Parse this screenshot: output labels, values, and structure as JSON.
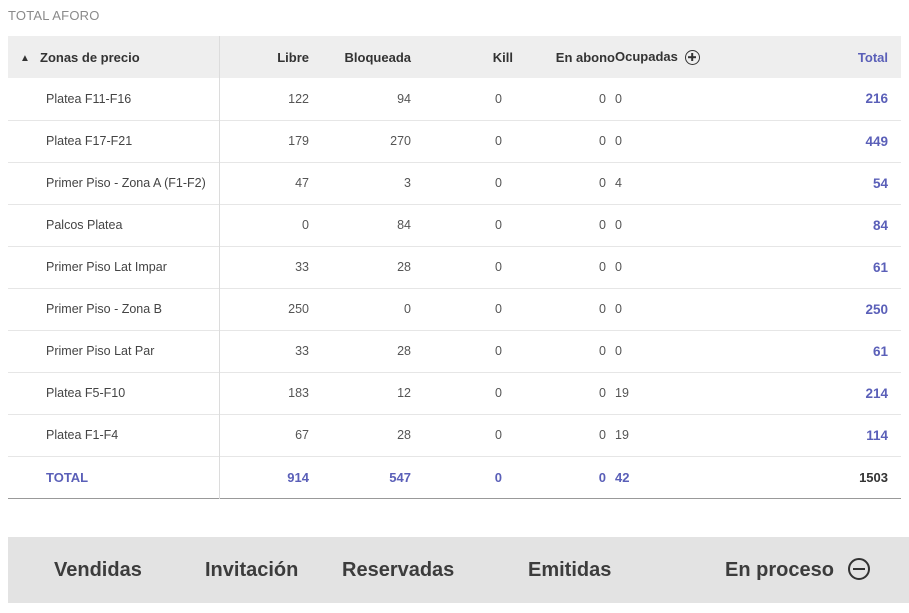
{
  "section_title": "TOTAL AFORO",
  "table": {
    "headers": {
      "zona": "Zonas de precio",
      "libre": "Libre",
      "bloqueada": "Bloqueada",
      "kill": "Kill",
      "abono": "En abono",
      "ocupadas": "Ocupadas",
      "total": "Total"
    },
    "rows": [
      {
        "zona": "Platea F11-F16",
        "libre": "122",
        "bloqueada": "94",
        "kill": "0",
        "abono": "0",
        "ocupadas": "0",
        "total": "216"
      },
      {
        "zona": "Platea F17-F21",
        "libre": "179",
        "bloqueada": "270",
        "kill": "0",
        "abono": "0",
        "ocupadas": "0",
        "total": "449"
      },
      {
        "zona": "Primer Piso - Zona A (F1-F2)",
        "libre": "47",
        "bloqueada": "3",
        "kill": "0",
        "abono": "0",
        "ocupadas": "4",
        "total": "54"
      },
      {
        "zona": "Palcos Platea",
        "libre": "0",
        "bloqueada": "84",
        "kill": "0",
        "abono": "0",
        "ocupadas": "0",
        "total": "84"
      },
      {
        "zona": "Primer Piso Lat Impar",
        "libre": "33",
        "bloqueada": "28",
        "kill": "0",
        "abono": "0",
        "ocupadas": "0",
        "total": "61"
      },
      {
        "zona": "Primer Piso - Zona B",
        "libre": "250",
        "bloqueada": "0",
        "kill": "0",
        "abono": "0",
        "ocupadas": "0",
        "total": "250"
      },
      {
        "zona": "Primer Piso Lat Par",
        "libre": "33",
        "bloqueada": "28",
        "kill": "0",
        "abono": "0",
        "ocupadas": "0",
        "total": "61"
      },
      {
        "zona": "Platea F5-F10",
        "libre": "183",
        "bloqueada": "12",
        "kill": "0",
        "abono": "0",
        "ocupadas": "19",
        "total": "214"
      },
      {
        "zona": "Platea F1-F4",
        "libre": "67",
        "bloqueada": "28",
        "kill": "0",
        "abono": "0",
        "ocupadas": "19",
        "total": "114"
      }
    ],
    "total_row": {
      "zona": "TOTAL",
      "libre": "914",
      "bloqueada": "547",
      "kill": "0",
      "abono": "0",
      "ocupadas": "42",
      "total": "1503"
    }
  },
  "bottom_tabs": {
    "vendidas": "Vendidas",
    "invitacion": "Invitación",
    "reservadas": "Reservadas",
    "emitidas": "Emitidas",
    "en_proceso": "En proceso"
  },
  "colors": {
    "accent": "#5a5fb8",
    "header_bg": "#eeeeee",
    "bottom_bar_bg": "#e3e3e3"
  },
  "icons": {
    "sort": "chevron-up-icon",
    "expand_ocupadas": "plus-circle-icon",
    "collapse_en_proceso": "minus-circle-icon"
  }
}
